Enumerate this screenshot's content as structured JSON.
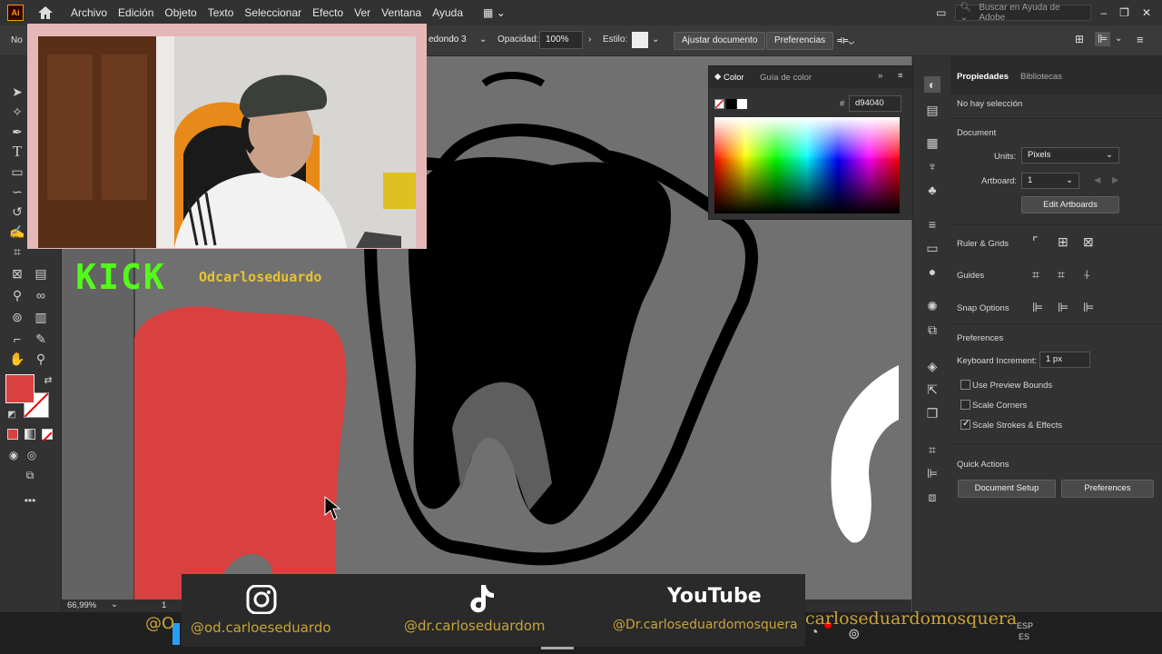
{
  "app": {
    "logo": "Ai"
  },
  "menu": [
    "Archivo",
    "Edición",
    "Objeto",
    "Texto",
    "Seleccionar",
    "Efecto",
    "Ver",
    "Ventana",
    "Ayuda"
  ],
  "search": {
    "placeholder": "Buscar en Ayuda de Adobe"
  },
  "control_bar": {
    "left_label": "No",
    "brush_value": "edondo 3 ...",
    "opacity_label": "Opacidad:",
    "opacity_value": "100%",
    "style_label": "Estilo:",
    "fit_button": "Ajustar documento",
    "prefs_button": "Preferencias"
  },
  "color_panel": {
    "tab_color": "Color",
    "tab_guide": "Guía de color",
    "hex_symbol": "#",
    "hex_value": "d94040"
  },
  "properties": {
    "tab_props": "Propiedades",
    "tab_libs": "Bibliotecas",
    "no_selection": "No hay selección",
    "document_label": "Document",
    "units_label": "Units:",
    "units_value": "Pixels",
    "artboard_label": "Artboard:",
    "artboard_value": "1",
    "edit_artboards": "Edit Artboards",
    "ruler_grids": "Ruler & Grids",
    "guides": "Guides",
    "snap_options": "Snap Options",
    "preferences_label": "Preferences",
    "keyboard_increment_label": "Keyboard Increment:",
    "keyboard_increment_value": "1 px",
    "use_preview_bounds": "Use Preview Bounds",
    "scale_corners": "Scale Corners",
    "scale_strokes": "Scale Strokes & Effects",
    "use_preview_bounds_checked": false,
    "scale_corners_checked": false,
    "scale_strokes_checked": true,
    "quick_actions": "Quick Actions",
    "document_setup": "Document Setup",
    "preferences_button": "Preferences"
  },
  "status": {
    "zoom": "66,99%",
    "artboard": "1"
  },
  "stream": {
    "kick_label": "KICK",
    "kick_handle": "Odcarloseduardo",
    "instagram": "@od.carloeseduardo",
    "tiktok": "@dr.carloseduardom",
    "youtube_label": "YouTube",
    "youtube": "@Dr.carloseduardomosquera",
    "ticker": "carloseduardomosquera",
    "ticker_left": "@O"
  },
  "colors": {
    "fill": "#d94040",
    "accent": "#c9a33a",
    "kick": "#53fc18"
  },
  "taskbar": {
    "lang": "ESP",
    "lang2": "ES"
  }
}
